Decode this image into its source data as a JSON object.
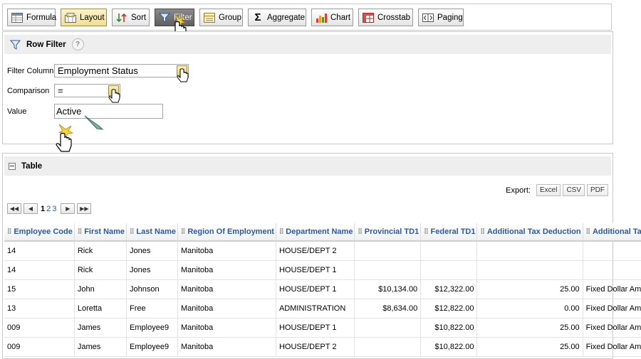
{
  "toolbar": {
    "buttons": [
      {
        "label": "Formula",
        "icon": "formula-icon"
      },
      {
        "label": "Layout",
        "icon": "layout-icon"
      },
      {
        "label": "Sort",
        "icon": "sort-icon"
      },
      {
        "label": "Filter",
        "icon": "filter-icon"
      },
      {
        "label": "Group",
        "icon": "group-icon"
      },
      {
        "label": "Aggregate",
        "icon": "sigma-icon"
      },
      {
        "label": "Chart",
        "icon": "chart-icon"
      },
      {
        "label": "Crosstab",
        "icon": "crosstab-icon"
      },
      {
        "label": "Paging",
        "icon": "paging-icon"
      }
    ]
  },
  "row_filter": {
    "title": "Row Filter",
    "help": "?",
    "filter_column_label": "Filter Column",
    "filter_column_value": "Employment Status",
    "comparison_label": "Comparison",
    "comparison_value": "=",
    "value_label": "Value",
    "value_value": "Active"
  },
  "table_panel": {
    "title": "Table",
    "export_label": "Export:",
    "export_buttons": [
      "Excel",
      "CSV",
      "PDF"
    ],
    "pager": {
      "current_page": "1",
      "pages": [
        "2",
        "3"
      ]
    },
    "columns": [
      "Employee Code",
      "First Name",
      "Last Name",
      "Region Of Employment",
      "Department Name",
      "Provincial TD1",
      "Federal TD1",
      "Additional Tax Deduction",
      "Additional Tax Type"
    ],
    "rows": [
      [
        "14",
        "Rick",
        "Jones",
        "Manitoba",
        "HOUSE/DEPT 2",
        "",
        "",
        "",
        ""
      ],
      [
        "14",
        "Rick",
        "Jones",
        "Manitoba",
        "HOUSE/DEPT 1",
        "",
        "",
        "",
        ""
      ],
      [
        "15",
        "John",
        "Johnson",
        "Manitoba",
        "HOUSE/DEPT 1",
        "$10,134.00",
        "$12,322.00",
        "25.00",
        "Fixed Dollar Amount"
      ],
      [
        "13",
        "Loretta",
        "Free",
        "Manitoba",
        "ADMINISTRATION",
        "$8,634.00",
        "$12,822.00",
        "0.00",
        "Fixed Dollar Amount"
      ],
      [
        "009",
        "James",
        "Employee9",
        "Manitoba",
        "HOUSE/DEPT 1",
        "",
        "$10,822.00",
        "25.00",
        "Fixed Dollar Amount"
      ],
      [
        "009",
        "James",
        "Employee9",
        "Manitoba",
        "HOUSE/DEPT 2",
        "",
        "$10,822.00",
        "25.00",
        "Fixed Dollar Amount"
      ]
    ]
  },
  "colors": {
    "accent": "#2b5aa3",
    "highlight": "#f0d060",
    "active_button": "#6e6e6e"
  }
}
